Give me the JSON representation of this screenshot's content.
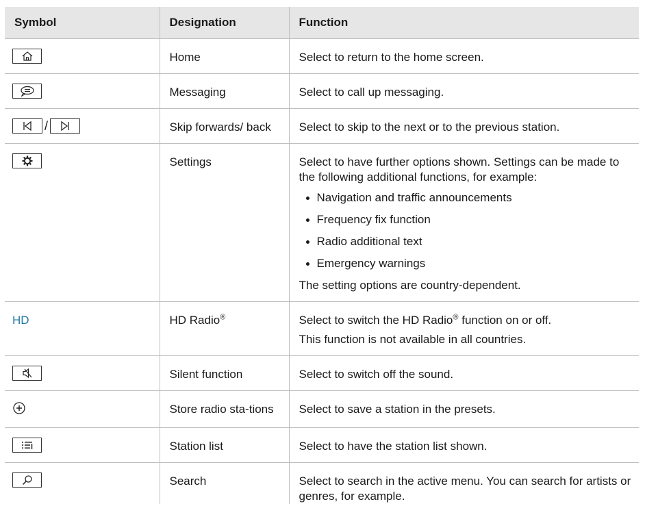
{
  "table": {
    "headers": {
      "symbol": "Symbol",
      "designation": "Designation",
      "function": "Function"
    },
    "rows": [
      {
        "symbol_icon": "home-icon",
        "designation": "Home",
        "function": "Select to return to the home screen."
      },
      {
        "symbol_icon": "messaging-icon",
        "designation": "Messaging",
        "function": "Select to call up messaging."
      },
      {
        "symbol_icon": "skip-back-icon / skip-forward-icon",
        "symbol_separator": "/",
        "designation": "Skip forwards/ back",
        "function": "Select to skip to the next or to the previous station."
      },
      {
        "symbol_icon": "settings-icon",
        "designation": "Settings",
        "function": "Select to have further options shown. Settings can be made to the following additional functions, for example:",
        "bullets": [
          "Navigation and traffic announcements",
          "Frequency fix function",
          "Radio additional text",
          "Emergency warnings"
        ],
        "note": "The setting options are country-dependent."
      },
      {
        "symbol_text": "HD",
        "designation": "HD Radio",
        "designation_sup": "®",
        "function_pre": "Select to switch the HD Radio",
        "function_sup": "®",
        "function_post": " function on or off.",
        "note": "This function is not available in all countries."
      },
      {
        "symbol_icon": "mute-speaker-icon",
        "designation": "Silent function",
        "function": "Select to switch off the sound."
      },
      {
        "symbol_icon": "add-circle-icon",
        "designation": "Store radio sta-tions",
        "function": "Select to save a station in the presets."
      },
      {
        "symbol_icon": "station-list-icon",
        "designation": "Station list",
        "function": "Select to have the station list shown."
      },
      {
        "symbol_icon": "search-icon",
        "designation": "Search",
        "function": "Select to search in the active menu. You can search for artists or genres, for example."
      }
    ]
  },
  "colors": {
    "header_bg": "#e6e6e6",
    "hd_text": "#1f7aa3",
    "rule": "#bfbfbf"
  }
}
